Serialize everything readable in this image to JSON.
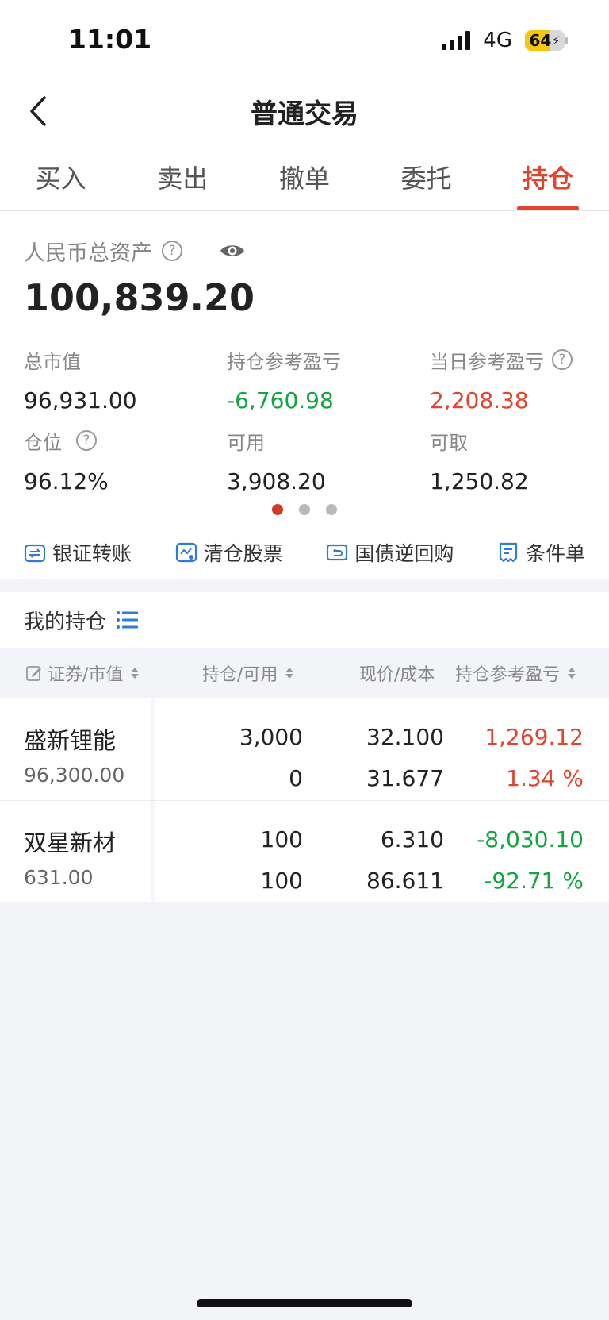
{
  "status": {
    "time": "11:01",
    "network": "4G",
    "battery": "64",
    "battery_level": 0.64
  },
  "nav": {
    "title": "普通交易"
  },
  "tabs": [
    {
      "label": "买入"
    },
    {
      "label": "卖出"
    },
    {
      "label": "撤单"
    },
    {
      "label": "委托"
    },
    {
      "label": "持仓",
      "active": true
    }
  ],
  "assets": {
    "label": "人民币总资产",
    "total": "100,839.20",
    "metrics": [
      {
        "label": "总市值",
        "value": "96,931.00"
      },
      {
        "label": "持仓参考盈亏",
        "value": "-6,760.98",
        "color": "green"
      },
      {
        "label": "当日参考盈亏",
        "value": "2,208.38",
        "color": "red",
        "help": true
      },
      {
        "label": "仓位",
        "value": "96.12%",
        "help": true
      },
      {
        "label": "可用",
        "value": "3,908.20"
      },
      {
        "label": "可取",
        "value": "1,250.82"
      }
    ]
  },
  "quick_actions": [
    {
      "label": "银证转账",
      "icon": "transfer-icon"
    },
    {
      "label": "清仓股票",
      "icon": "chart-clear-icon"
    },
    {
      "label": "国债逆回购",
      "icon": "repo-icon"
    },
    {
      "label": "条件单",
      "icon": "condition-order-icon"
    }
  ],
  "holdings": {
    "title": "我的持仓",
    "columns": [
      "证券/市值",
      "持仓/可用",
      "现价/成本",
      "持仓参考盈亏"
    ],
    "rows": [
      {
        "name": "盛新锂能",
        "market_value": "96,300.00",
        "position": "3,000",
        "available": "0",
        "price": "32.100",
        "cost": "31.677",
        "pnl": "1,269.12",
        "pnl_pct": "1.34 %",
        "color": "red"
      },
      {
        "name": "双星新材",
        "market_value": "631.00",
        "position": "100",
        "available": "100",
        "price": "6.310",
        "cost": "86.611",
        "pnl": "-8,030.10",
        "pnl_pct": "-92.71 %",
        "color": "green"
      }
    ]
  },
  "colors": {
    "accent": "#e2452d",
    "gain": "#e2452d",
    "loss": "#15a540"
  }
}
